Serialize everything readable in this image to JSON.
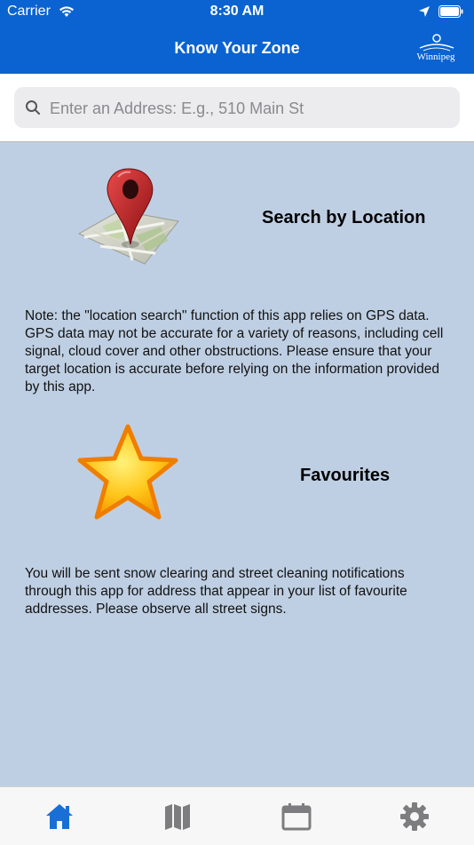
{
  "status_bar": {
    "carrier": "Carrier",
    "time": "8:30 AM"
  },
  "nav": {
    "title": "Know Your Zone",
    "logo_text": "Winnipeg"
  },
  "search": {
    "placeholder": "Enter an Address: E.g., 510 Main St",
    "value": ""
  },
  "sections": {
    "location": {
      "heading": "Search by Location",
      "note": "Note: the \"location search\" function of this app relies on GPS data. GPS data may not be accurate for a variety of reasons, including cell signal, cloud cover and other obstructions. Please ensure that your target location is accurate before relying on the information provided by this app.",
      "icon": "map-pin-icon"
    },
    "favourites": {
      "heading": "Favourites",
      "note": "You will be sent snow clearing and street cleaning notifications through this app for address that appear in your list of favourite addresses. Please observe all street signs.",
      "icon": "star-icon"
    }
  },
  "tabs": [
    {
      "icon": "home-icon",
      "active": true
    },
    {
      "icon": "map-icon",
      "active": false
    },
    {
      "icon": "calendar-icon",
      "active": false
    },
    {
      "icon": "gear-icon",
      "active": false
    }
  ],
  "colors": {
    "nav_blue": "#0a63d1",
    "content_bg": "#bfcfe3",
    "tab_active": "#1a6fd6",
    "tab_inactive": "#7d7d80"
  }
}
